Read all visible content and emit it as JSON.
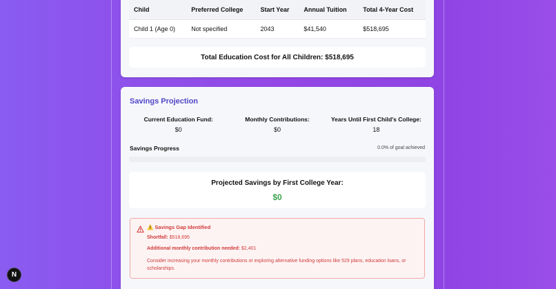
{
  "cost_table": {
    "headers": [
      "Child",
      "Preferred College",
      "Start Year",
      "Annual Tuition",
      "Total 4-Year Cost"
    ],
    "rows": [
      [
        "Child 1 (Age 0)",
        "Not specified",
        "2043",
        "$41,540",
        "$518,695"
      ]
    ]
  },
  "total_cost": "Total Education Cost for All Children: $518,695",
  "savings": {
    "title": "Savings Projection",
    "stats": [
      {
        "label": "Current Education Fund:",
        "value": "$0"
      },
      {
        "label": "Monthly Contributions:",
        "value": "$0"
      },
      {
        "label": "Years Until First Child's College:",
        "value": "18"
      }
    ],
    "progress_label": "Savings Progress",
    "progress_text": "0.0% of goal achieved",
    "progress_fraction": 0.0,
    "projected_label": "Projected Savings by First College Year:",
    "projected_value": "$0"
  },
  "gap": {
    "title": "⚠️ Savings Gap Identified",
    "shortfall_label": "Shortfall:",
    "shortfall_value": "$518,695",
    "monthly_label": "Additional monthly contribution needed:",
    "monthly_value": "$2,401",
    "advice": "Consider increasing your monthly contributions or exploring alternative funding options like 529 plans, education loans, or scholarships."
  },
  "badge": "N",
  "colors": {
    "accent": "#4f46c8",
    "success": "#3aa34d",
    "danger": "#d13a3a"
  }
}
